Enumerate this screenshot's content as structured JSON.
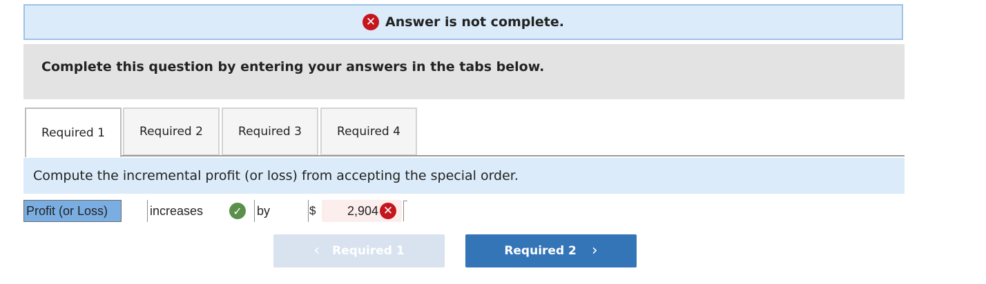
{
  "banner": {
    "message": "Answer is not complete.",
    "icon": "x-circle-icon",
    "color": "#c4161c"
  },
  "instructions": {
    "text": "Complete this question by entering your answers in the tabs below."
  },
  "tabs": [
    {
      "label": "Required 1",
      "active": true
    },
    {
      "label": "Required 2",
      "active": false
    },
    {
      "label": "Required 3",
      "active": false
    },
    {
      "label": "Required 4",
      "active": false
    }
  ],
  "question": {
    "text": "Compute the incremental profit (or loss) from accepting the special order."
  },
  "answer_row": {
    "label": "Profit (or Loss)",
    "direction_value": "increases",
    "direction_status": "correct",
    "by_text": "by",
    "currency": "$",
    "amount": "2,904",
    "amount_status": "incorrect"
  },
  "navigation": {
    "prev_label": "Required 1",
    "next_label": "Required 2",
    "prev_enabled": false,
    "next_enabled": true
  },
  "colors": {
    "banner_bg": "#dbebf9",
    "next_button": "#3475b8",
    "correct": "#5a8f4c",
    "incorrect": "#c4161c"
  }
}
